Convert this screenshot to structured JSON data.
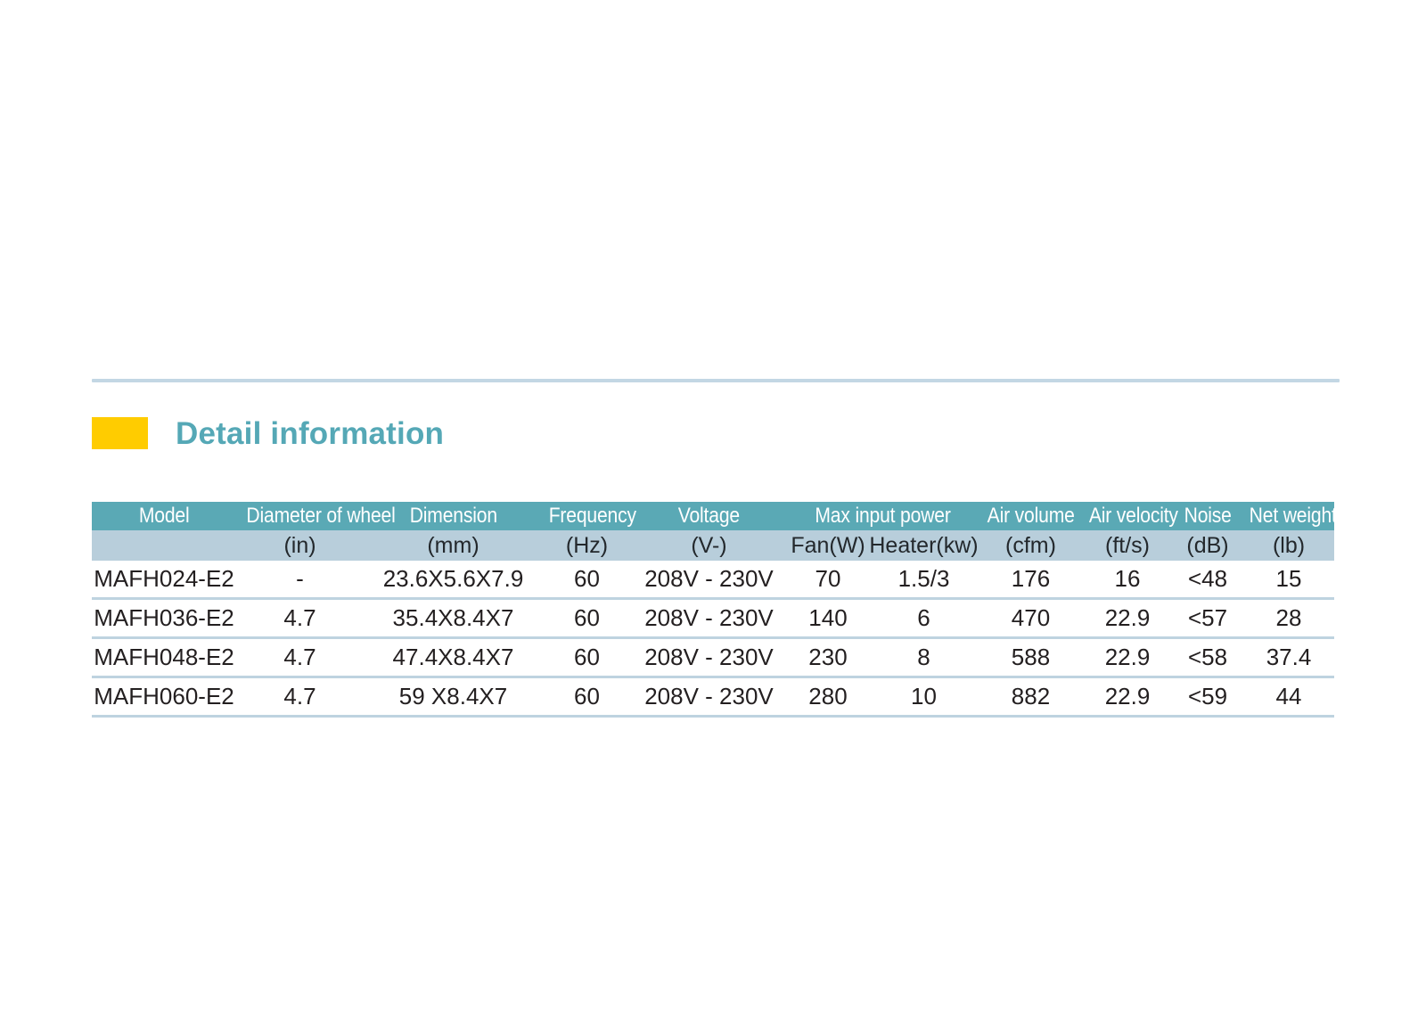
{
  "section": {
    "title": "Detail information",
    "swatch_color": "#ffcc00",
    "title_color": "#55a8b6",
    "rule_color": "#c3d7e4"
  },
  "table": {
    "header_bg": "#5aa9b5",
    "subheader_bg": "#b8cedb",
    "row_divider_color": "#bed3e0",
    "group_headers": [
      {
        "label": "Model",
        "span": 1
      },
      {
        "label": "Diameter of wheel",
        "span": 1
      },
      {
        "label": "Dimension",
        "span": 1
      },
      {
        "label": "Frequency",
        "span": 1
      },
      {
        "label": "Voltage",
        "span": 1
      },
      {
        "label": "Max input power",
        "span": 2
      },
      {
        "label": "Air volume",
        "span": 1
      },
      {
        "label": "Air velocity",
        "span": 1
      },
      {
        "label": "Noise",
        "span": 1
      },
      {
        "label": "Net weight",
        "span": 1
      }
    ],
    "unit_headers": [
      "",
      "(in)",
      "(mm)",
      "(Hz)",
      "(V-)",
      "Fan(W)",
      "Heater(kw)",
      "(cfm)",
      "(ft/s)",
      "(dB)",
      "(lb)"
    ],
    "rows": [
      {
        "model": "MAFH024-E2",
        "wheel": "-",
        "dimension": "23.6X5.6X7.9",
        "frequency": "60",
        "voltage": "208V - 230V",
        "fan": "70",
        "heater": "1.5/3",
        "air_volume": "176",
        "air_velocity": "16",
        "noise": "<48",
        "net_weight": "15"
      },
      {
        "model": "MAFH036-E2",
        "wheel": "4.7",
        "dimension": "35.4X8.4X7",
        "frequency": "60",
        "voltage": "208V - 230V",
        "fan": "140",
        "heater": "6",
        "air_volume": "470",
        "air_velocity": "22.9",
        "noise": "<57",
        "net_weight": "28"
      },
      {
        "model": "MAFH048-E2",
        "wheel": "4.7",
        "dimension": "47.4X8.4X7",
        "frequency": "60",
        "voltage": "208V - 230V",
        "fan": "230",
        "heater": "8",
        "air_volume": "588",
        "air_velocity": "22.9",
        "noise": "<58",
        "net_weight": "37.4"
      },
      {
        "model": "MAFH060-E2",
        "wheel": "4.7",
        "dimension": "59 X8.4X7",
        "frequency": "60",
        "voltage": "208V - 230V",
        "fan": "280",
        "heater": "10",
        "air_volume": "882",
        "air_velocity": "22.9",
        "noise": "<59",
        "net_weight": "44"
      }
    ]
  }
}
